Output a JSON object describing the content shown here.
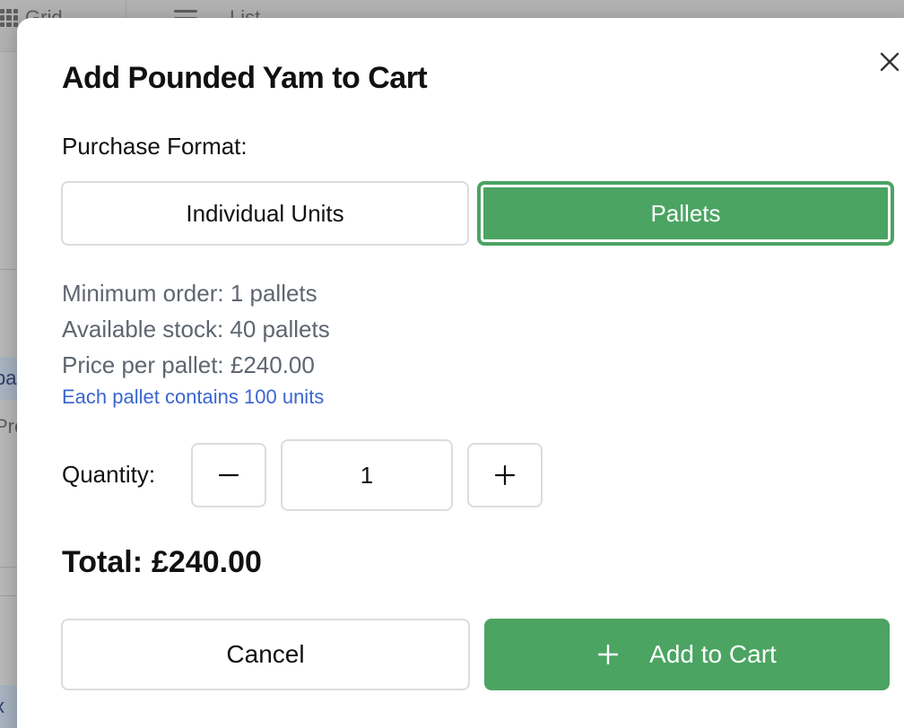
{
  "background": {
    "view_grid_label": "Grid",
    "view_list_label": "List",
    "peek_texts": [
      "pa",
      "Pre",
      "x"
    ]
  },
  "modal": {
    "title": "Add Pounded Yam to Cart",
    "close_icon": "close-icon",
    "format_label": "Purchase Format:",
    "formats": [
      {
        "label": "Individual Units",
        "selected": false
      },
      {
        "label": "Pallets",
        "selected": true
      }
    ],
    "info": {
      "minimum_order": "Minimum order: 1 pallets",
      "available_stock": "Available stock: 40 pallets",
      "price_per_pallet": "Price per pallet: £240.00",
      "pallet_note": "Each pallet contains 100 units"
    },
    "quantity": {
      "label": "Quantity:",
      "value": "1",
      "minus_icon": "minus-icon",
      "plus_icon": "plus-icon"
    },
    "total": {
      "label": "Total:",
      "value": "£240.00"
    },
    "actions": {
      "cancel_label": "Cancel",
      "add_label": "Add to Cart",
      "add_icon": "plus-icon"
    }
  },
  "colors": {
    "accent_green": "#4ba462",
    "note_blue": "#3a66d0",
    "muted_text": "#5f6670",
    "border": "#dcdcdc"
  }
}
